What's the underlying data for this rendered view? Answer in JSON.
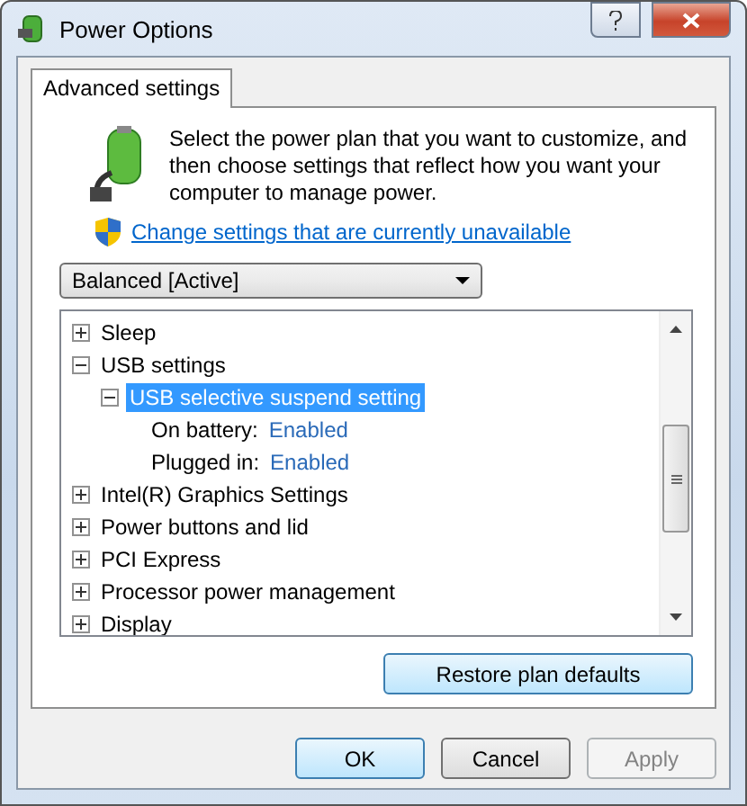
{
  "window": {
    "title": "Power Options"
  },
  "tabs": [
    {
      "label": "Advanced settings",
      "selected": true
    }
  ],
  "description": "Select the power plan that you want to customize, and then choose settings that reflect how you want your computer to manage power.",
  "link": "Change settings that are currently unavailable",
  "plan_dropdown": {
    "value": "Balanced [Active]"
  },
  "tree": [
    {
      "kind": "group",
      "label": "Sleep",
      "expanded": false,
      "selected": false
    },
    {
      "kind": "group",
      "label": "USB settings",
      "expanded": true,
      "selected": false,
      "children": [
        {
          "kind": "group",
          "label": "USB selective suspend setting",
          "expanded": true,
          "selected": true,
          "children": [
            {
              "kind": "setting",
              "label": "On battery:",
              "value": "Enabled"
            },
            {
              "kind": "setting",
              "label": "Plugged in:",
              "value": "Enabled"
            }
          ]
        }
      ]
    },
    {
      "kind": "group",
      "label": "Intel(R) Graphics Settings",
      "expanded": false,
      "selected": false
    },
    {
      "kind": "group",
      "label": "Power buttons and lid",
      "expanded": false,
      "selected": false
    },
    {
      "kind": "group",
      "label": "PCI Express",
      "expanded": false,
      "selected": false
    },
    {
      "kind": "group",
      "label": "Processor power management",
      "expanded": false,
      "selected": false
    },
    {
      "kind": "group",
      "label": "Display",
      "expanded": false,
      "selected": false
    }
  ],
  "restore_button": "Restore plan defaults",
  "buttons": [
    {
      "label": "OK",
      "disabled": false,
      "default": true
    },
    {
      "label": "Cancel",
      "disabled": false,
      "default": false
    },
    {
      "label": "Apply",
      "disabled": true,
      "default": false
    }
  ]
}
